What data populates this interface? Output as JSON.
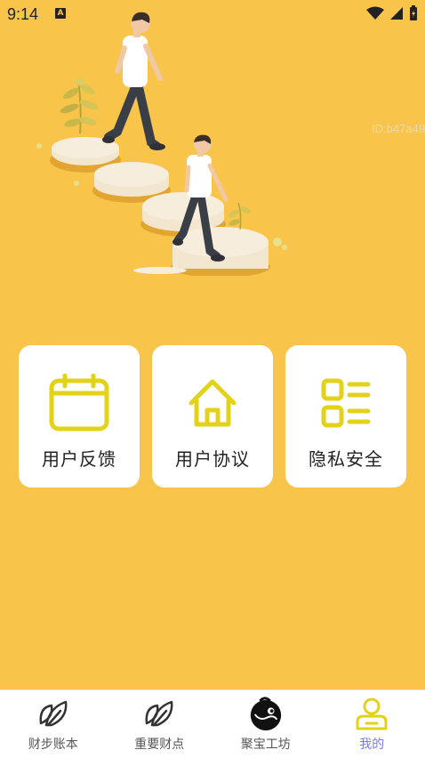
{
  "status_bar": {
    "time": "9:14",
    "notification_letter": "A"
  },
  "watermark_id": "ID:b47a49",
  "cards": [
    {
      "label": "用户反馈",
      "icon": "calendar-icon"
    },
    {
      "label": "用户协议",
      "icon": "home-icon"
    },
    {
      "label": "隐私安全",
      "icon": "list-icon"
    }
  ],
  "tabs": [
    {
      "label": "财步账本",
      "icon": "leaf-icon",
      "active": false
    },
    {
      "label": "重要财点",
      "icon": "leaf-icon",
      "active": false
    },
    {
      "label": "聚宝工坊",
      "icon": "treasure-icon",
      "active": false
    },
    {
      "label": "我的",
      "icon": "user-icon",
      "active": true
    }
  ],
  "colors": {
    "background": "#F8C54A",
    "icon_accent": "#E2D21A",
    "active_tab": "#7A7CE8"
  }
}
